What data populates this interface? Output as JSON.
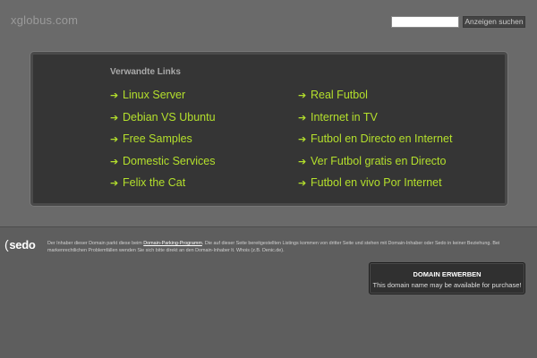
{
  "header": {
    "site_title": "xglobus.com",
    "search_placeholder": "",
    "search_button": "Anzeigen suchen"
  },
  "links": {
    "heading": "Verwandte Links",
    "arrow_glyph": "➔",
    "left": [
      "Linux Server",
      "Debian VS Ubuntu",
      "Free Samples",
      "Domestic Services",
      "Felix the Cat"
    ],
    "right": [
      "Real Futbol",
      "Internet in TV",
      "Futbol en Directo en Internet",
      "Ver Futbol gratis en Directo",
      "Futbol en vivo Por Internet"
    ]
  },
  "footer": {
    "logo_text": "sedo",
    "disclaimer_before": "Der Inhaber dieser Domain parkt diese beim ",
    "disclaimer_link": "Domain-Parking-Programm",
    "disclaimer_after": ". Die auf dieser Seite bereitgestellten Listings kommen von dritter Seite und stehen mit Domain-Inhaber oder Sedo in keiner Beziehung. Bei markenrechtlichen Problemfällen wenden Sie sich bitte direkt an den Domain-Inhaber lt. Whois (z.B. Denic.de).",
    "domain_box_title": "DOMAIN ERWERBEN",
    "domain_box_subtitle": "This domain name may be available for purchase!"
  },
  "colors": {
    "link": "#b4e02c",
    "panel_bg": "#353535",
    "page_bg": "#5e5e5e",
    "header_bg": "#6a6a6a"
  }
}
